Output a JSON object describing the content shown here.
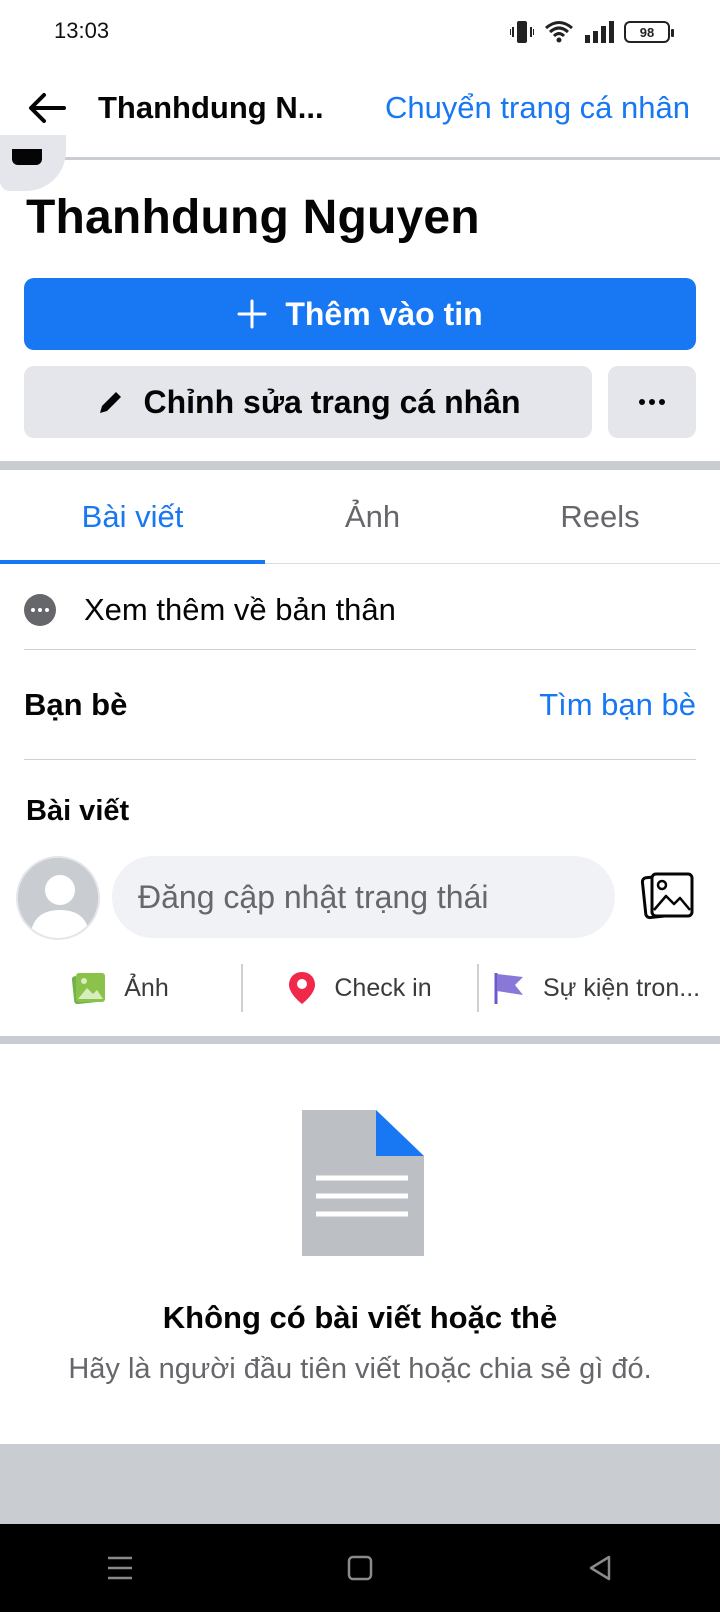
{
  "status_bar": {
    "time": "13:03",
    "battery": "98",
    "icons": [
      "vibrate-icon",
      "wifi-icon",
      "signal-icon",
      "battery-icon"
    ]
  },
  "header": {
    "title": "Thanhdung N...",
    "switch_profile_link": "Chuyển trang cá nhân"
  },
  "profile": {
    "name": "Thanhdung Nguyen",
    "add_to_story_label": "Thêm vào tin",
    "edit_profile_label": "Chỉnh sửa trang cá nhân"
  },
  "tabs": [
    {
      "label": "Bài viết",
      "active": true
    },
    {
      "label": "Ảnh",
      "active": false
    },
    {
      "label": "Reels",
      "active": false
    }
  ],
  "about": {
    "label": "Xem thêm về bản thân"
  },
  "friends": {
    "title": "Bạn bè",
    "find_link": "Tìm bạn bè"
  },
  "posts": {
    "title": "Bài viết",
    "composer_placeholder": "Đăng cập nhật trạng thái",
    "actions": [
      {
        "label": "Ảnh",
        "icon": "photo-icon"
      },
      {
        "label": "Check in",
        "icon": "location-pin-icon"
      },
      {
        "label": "Sự kiện tron...",
        "icon": "flag-icon"
      }
    ]
  },
  "empty_state": {
    "title": "Không có bài viết hoặc thẻ",
    "subtitle": "Hãy là người đầu tiên viết hoặc chia sẻ gì đó."
  },
  "colors": {
    "accent": "#1877F2",
    "button_gray": "#e4e6eb",
    "divider": "#c9ccd1",
    "secondary_text": "#65676B",
    "photo_green": "#8bc34a",
    "pin_red": "#f02849",
    "flag_purple": "#8a78d8"
  }
}
